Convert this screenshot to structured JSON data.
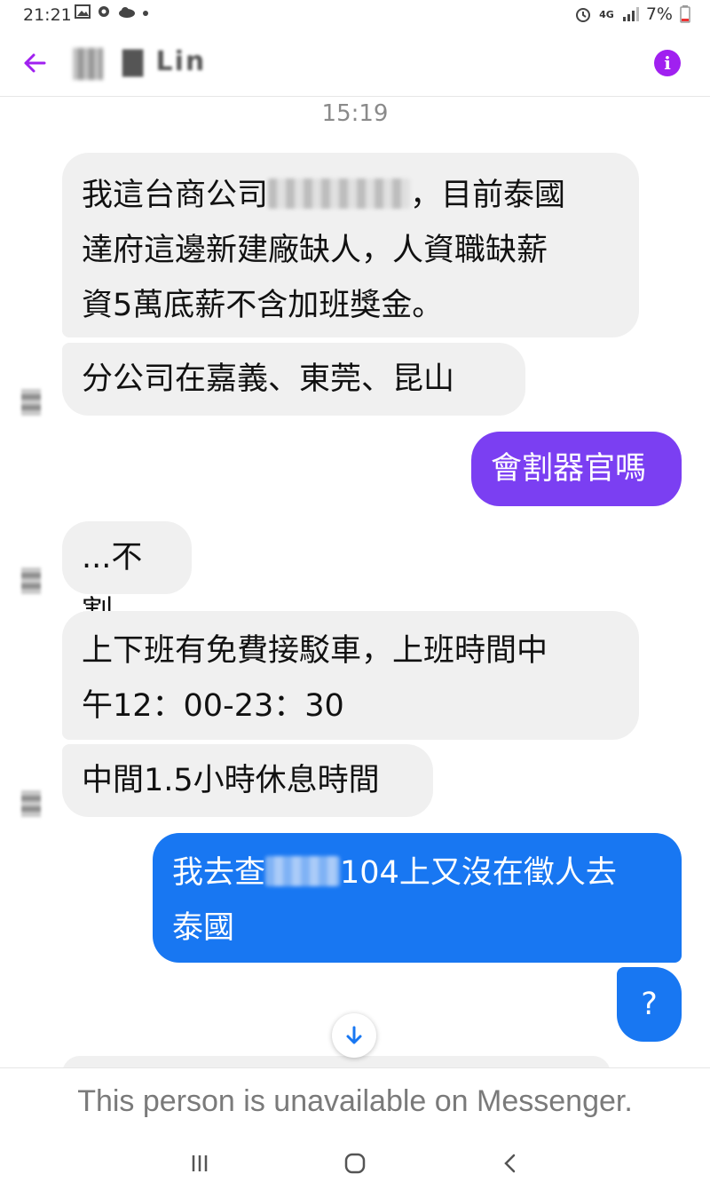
{
  "status": {
    "time": "21:21",
    "network": "4G",
    "battery": "7%"
  },
  "header": {
    "contact_name": "▇ Lin"
  },
  "conversation": {
    "timestamp": "15:19",
    "msg1": {
      "part1": "我這台商公司",
      "redacted": "▇▇▇▇",
      "part2": "，目前泰國",
      "line2": "達府這邊新建廠缺人，人資職缺薪",
      "line3": "資5萬底薪不含加班獎金。"
    },
    "msg2": "分公司在嘉義、東莞、昆山",
    "msg3": "會割器官嗎",
    "msg4": "...不割",
    "msg5": {
      "line1": "上下班有免費接駁車，上班時間中",
      "line2": "午12：00-23：30"
    },
    "msg6": "中間1.5小時休息時間",
    "msg7": {
      "part1": "我去查",
      "redacted": "▇▇",
      "part2": "104上又沒在徵人去",
      "line2": "泰國"
    },
    "msg8": "?"
  },
  "footer": {
    "unavailable_text": "This person is unavailable on Messenger."
  },
  "colors": {
    "purple": "#7b3ff2",
    "blue": "#1877f2",
    "incoming": "#f0f0f0"
  }
}
